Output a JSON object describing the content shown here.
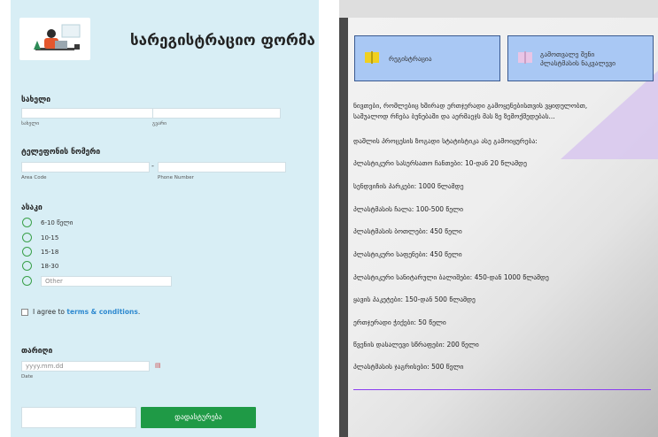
{
  "form": {
    "title": "სარეგისტრაციო ფორმა",
    "name_label": "სახელი",
    "first_sub": "სახელი",
    "last_sub": "გვარი",
    "phone_label": "ტელეფონის ნომერი",
    "phone_dash": "-",
    "area_sub": "Area Code",
    "phone_sub": "Phone Number",
    "age_label": "ასაკი",
    "age_options": [
      "6-10 წელი",
      "10-15",
      "15-18",
      "18-30"
    ],
    "other_placeholder": "Other",
    "agree_text": "I agree to",
    "agree_link": "terms & conditions",
    "agree_end": ".",
    "date_label": "თარიღი",
    "date_placeholder": "yyyy.mm.dd",
    "date_sub": "Date",
    "submit_label": "დადასტურება",
    "calendar_icon": "calendar-icon"
  },
  "right": {
    "tile1": "რეგისტრაცია",
    "tile2_line1": "გამოთვალე შენი",
    "tile2_line2": "პლასტმასის ნაკვალევი",
    "intro_line1": "ნივთები, რომლებიც ხშირად ერთჯერადი გამოყენებისთვის ვყიდულობთ,",
    "intro_line2": "საშუალოდ რჩება ბუნებაში და აერმაეჯს მას ზე ზემოქმედებას...",
    "stats_heading": "დაშლის პროცესის ზოგადი სტატისტიკა  ასე გამოიყურება:",
    "items": [
      "პლასტიკური სასურსათო ჩანთები: 10-დან 20 წლამდე",
      "სენდვიჩის პარკები: 1000 წლამდე",
      "პლასტმასის ჩალა: 100-500 წელი",
      "პლასტმასის ბოთლები: 450 წელი",
      "პლასტიკური საფენები: 450 წელი",
      "პლასტიკური სანიტარული ბალიშები: 450-დან 1000 წლამდე",
      "ყავის პაკეტები: 150-დან 500 წლამდე",
      "ერთჯერადი ჭიქები: 50 წელი",
      "წვენის დასალევი სწრაფები: 200 წელი",
      "პლასტმასის ჯაგრისები: 500 წელი"
    ]
  }
}
